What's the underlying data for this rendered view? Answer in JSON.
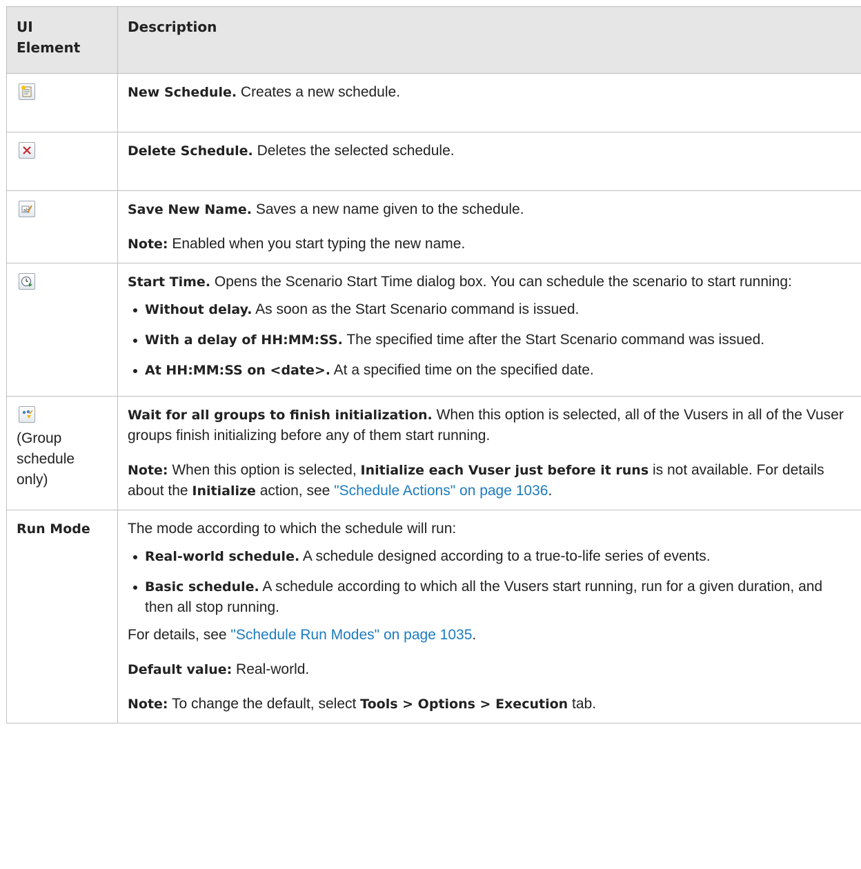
{
  "headers": {
    "col1": "UI Element",
    "col1_line1": "UI",
    "col1_line2": "Element",
    "col2": "Description"
  },
  "rows": {
    "new_schedule": {
      "icon": "new-schedule-icon",
      "title": "New Schedule.",
      "text": " Creates a new schedule."
    },
    "delete_schedule": {
      "icon": "delete-icon",
      "title": "Delete Schedule.",
      "text": " Deletes the selected schedule."
    },
    "save_name": {
      "icon": "rename-icon",
      "title": "Save New Name.",
      "text": " Saves a new name given to the schedule.",
      "note_label": "Note:",
      "note_text": " Enabled when you start typing the new name."
    },
    "start_time": {
      "icon": "clock-icon",
      "title": "Start Time.",
      "text": " Opens the Scenario Start Time dialog box. You can schedule the scenario to start running:",
      "bullets": [
        {
          "b": "Without delay.",
          "t": " As soon as the Start Scenario command is issued."
        },
        {
          "b": "With a delay of HH:MM:SS.",
          "t": " The specified time after the Start Scenario command was issued."
        },
        {
          "b": "At HH:MM:SS on <date>.",
          "t": " At a specified time on the specified date."
        }
      ]
    },
    "wait_init": {
      "icon": "wait-init-icon",
      "caption": "(Group schedule only)",
      "title": "Wait for all groups to finish initialization.",
      "text": " When this option is selected, all of the Vusers in all of the Vuser groups finish initializing before any of them start running.",
      "note_label": "Note:",
      "note_a": " When this option is selected, ",
      "note_b": "Initialize each Vuser just before it runs",
      "note_c": " is not available. For details about the ",
      "note_d": "Initialize",
      "note_e": " action, see ",
      "link": "\"Schedule Actions\" on page 1036",
      "note_f": "."
    },
    "run_mode": {
      "label": "Run Mode",
      "intro": "The mode according to which the schedule will run:",
      "bullets": [
        {
          "b": "Real-world schedule.",
          "t": " A schedule designed according to a true-to-life series of events."
        },
        {
          "b": "Basic schedule.",
          "t": " A schedule according to which all the Vusers start running, run for a given duration, and then all stop running."
        }
      ],
      "details_a": "For details, see ",
      "details_link": "\"Schedule Run Modes\" on page 1035",
      "details_b": ".",
      "default_label": "Default value:",
      "default_text": " Real-world.",
      "note_label": "Note:",
      "note_a": " To change the default, select ",
      "note_b": "Tools > Options > Execution",
      "note_c": " tab."
    }
  }
}
